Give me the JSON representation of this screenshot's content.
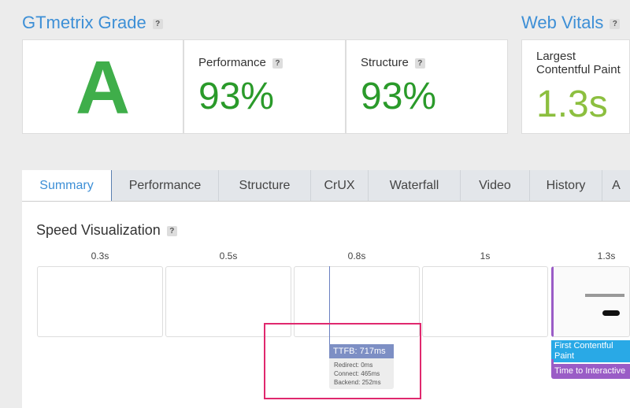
{
  "grade": {
    "title": "GTmetrix Grade",
    "letter": "A",
    "performance_label": "Performance",
    "performance": "93%",
    "structure_label": "Structure",
    "structure": "93%"
  },
  "vitals": {
    "title": "Web Vitals",
    "lcp_label": "Largest Contentful Paint",
    "lcp": "1.3s"
  },
  "help": "?",
  "tabs": [
    "Summary",
    "Performance",
    "Structure",
    "CrUX",
    "Waterfall",
    "Video",
    "History",
    "A"
  ],
  "speed": {
    "title": "Speed Visualization",
    "times": [
      "0.3s",
      "0.5s",
      "0.8s",
      "1s",
      "1.3s"
    ],
    "ttfb": {
      "title": "TTFB: 717ms",
      "redirect": "Redirect: 0ms",
      "connect": "Connect: 465ms",
      "backend": "Backend: 252ms"
    },
    "fcp": "First Contentful Paint",
    "tti": "Time to Interactive"
  }
}
